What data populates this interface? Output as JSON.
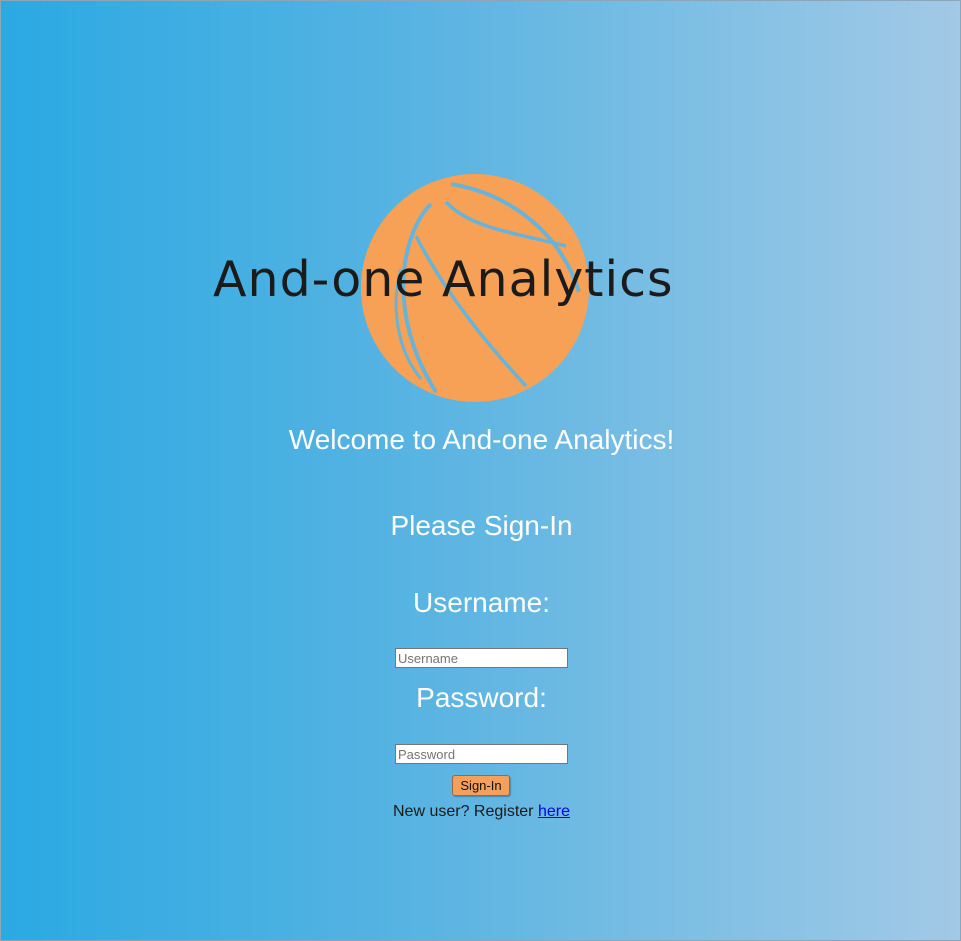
{
  "logo": {
    "text": "And-one Analytics",
    "icon": "basketball-icon",
    "ball_color": "#f6a155",
    "seam_color": "#69b3d8",
    "text_color": "#1b1b1b"
  },
  "welcome": "Welcome to And-one Analytics!",
  "subtitle": "Please Sign-In",
  "form": {
    "username_label": "Username:",
    "username_placeholder": "Username",
    "username_value": "",
    "password_label": "Password:",
    "password_placeholder": "Password",
    "password_value": "",
    "submit_label": "Sign-In"
  },
  "register": {
    "prompt": "New user? Register",
    "link_text": "here"
  },
  "colors": {
    "background_left": "#2aa9e3",
    "background_right": "#a2c9e6",
    "button": "#f4a05a",
    "link": "#0000ee",
    "heading_text": "#ffffff"
  }
}
